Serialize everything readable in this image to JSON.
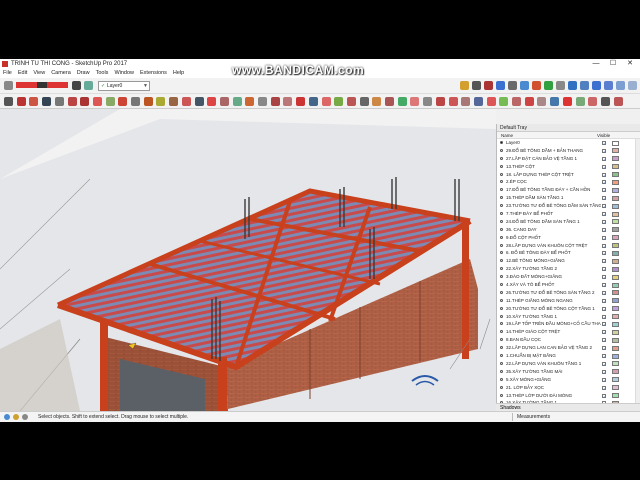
{
  "window": {
    "title": "TRINH TU THI CONG - SketchUp Pro 2017",
    "minimize": "—",
    "maximize": "☐",
    "close": "✕"
  },
  "menu": [
    "File",
    "Edit",
    "View",
    "Camera",
    "Draw",
    "Tools",
    "Window",
    "Extensions",
    "Help"
  ],
  "watermark": {
    "brand": "www.BANDICAM.com",
    "resolution": "1920x1080"
  },
  "layer_selector": {
    "current": "Layer0"
  },
  "colors": {
    "steel_red": "#c8401c",
    "brick": "#b8664a",
    "deck_stripe_red": "#c94a4a",
    "deck_stripe_blue": "#7d8ab3"
  },
  "tray": {
    "title": "Default Tray",
    "col_name": "Name",
    "col_visible": "Visible",
    "layers": [
      {
        "name": "Layer0",
        "active": true,
        "color": "#ffffff"
      },
      {
        "name": "29.ĐỔ BÊ TÔNG DẦM + BẢN THANG",
        "color": "#e2b0a6"
      },
      {
        "name": "27.LẮP ĐẶT CÁN BẢO VỆ TẦNG 1",
        "color": "#c8a0c8"
      },
      {
        "name": "13.THÉP CỘT",
        "color": "#d6c08c"
      },
      {
        "name": "18. LẮP DỰNG THÉP CỘT TRỆT",
        "color": "#8cc08c"
      },
      {
        "name": "2.ÉP CỌC",
        "color": "#f0a080"
      },
      {
        "name": "17.ĐỔ BÊ TÔNG TẦNG ĐÁY + CẦN HỒN",
        "color": "#b0b0e0"
      },
      {
        "name": "15.THÉP DẦM SÀN TẦNG 1",
        "color": "#d4a0a0"
      },
      {
        "name": "23.TƯỜNG TƯ ĐỔ BÊ TÔNG DẦM SÀN TẦNG MÁI",
        "color": "#a0c0d8"
      },
      {
        "name": "7.THÉP ĐÀY BỂ PHỐT",
        "color": "#e0c0a0"
      },
      {
        "name": "24.ĐỔ BÊ TÔNG DẦM SÀN TẦNG 1",
        "color": "#c0e0a0"
      },
      {
        "name": "36. CANG DAY",
        "color": "#a0a0a0"
      },
      {
        "name": "9.ĐỔ CỘT PHỐT",
        "color": "#e0a0c0"
      },
      {
        "name": "28.LẮP DỰNG VÁN KHUÔN CỘT TRỆT",
        "color": "#c0c080"
      },
      {
        "name": "6. ĐỔ BÊ TÔNG ĐÀY BỂ PHỐT",
        "color": "#80b0b0"
      },
      {
        "name": "12.BÊ TÔNG MÓNG+GIẰNG",
        "color": "#d0b090"
      },
      {
        "name": "22.XÂY TƯỜNG TẦNG 2",
        "color": "#b090d0"
      },
      {
        "name": "3.ĐÀO ĐẤT MÓNG+GIẰNG",
        "color": "#e0d080"
      },
      {
        "name": "4.XÂY VÀ TÔ BỂ PHỐT",
        "color": "#90d0b0"
      },
      {
        "name": "26.TƯỜNG TƯ ĐỔ BÊ TÔNG SÀN TẦNG 2",
        "color": "#d09090"
      },
      {
        "name": "11.THÉP GIẰNG MÓNG NGANG",
        "color": "#90a0d0"
      },
      {
        "name": "20.TƯỜNG TƯ ĐỔ BÊ TÔNG CỘT TẦNG 1",
        "color": "#c0a0e0"
      },
      {
        "name": "10.XÂY TƯỜNG TẦNG 1",
        "color": "#e0b0b0"
      },
      {
        "name": "19.LẮP TỐP TRÊN ĐẦU MÓNG+CỐ CẦU THANG",
        "color": "#a0d0d0"
      },
      {
        "name": "14.THÉP GIÁO CỘT TRỆT",
        "color": "#d0d0a0"
      },
      {
        "name": "8.BAN ĐẦU CỌC",
        "color": "#b0c0a0"
      },
      {
        "name": "32.LẮP DỰNG LAN CAN BẢO VỆ TẦNG 2",
        "color": "#e0a090"
      },
      {
        "name": "1.CHUẨN BỊ MẶT BẰNG",
        "color": "#a0b0e0"
      },
      {
        "name": "22.LẮP DỰNG VÁN KHUÔN TẦNG 1",
        "color": "#c0e0c0"
      },
      {
        "name": "35.XÂY TƯỜNG TẦNG MÁI",
        "color": "#d0a0b0"
      },
      {
        "name": "5.XÂY MÓNG+GIẰNG",
        "color": "#b0d0e0"
      },
      {
        "name": "21. LỚP BẢY XỌC",
        "color": "#e0c0d0"
      },
      {
        "name": "13.THÉP LỚP DƯỚI ĐÀI MÓNG",
        "color": "#a0e0b0"
      },
      {
        "name": "16.XÂY TƯỜNG TẦNG 1",
        "color": "#d0b0a0"
      },
      {
        "name": "23.ĐỔ BÊ TÔNG CỘT TRỆT",
        "color": "#c0c0e0"
      }
    ],
    "shadows_label": "Shadows"
  },
  "statusbar": {
    "message": "Select objects. Shift to extend select. Drag mouse to select multiple.",
    "measurements_label": "Measurements"
  }
}
